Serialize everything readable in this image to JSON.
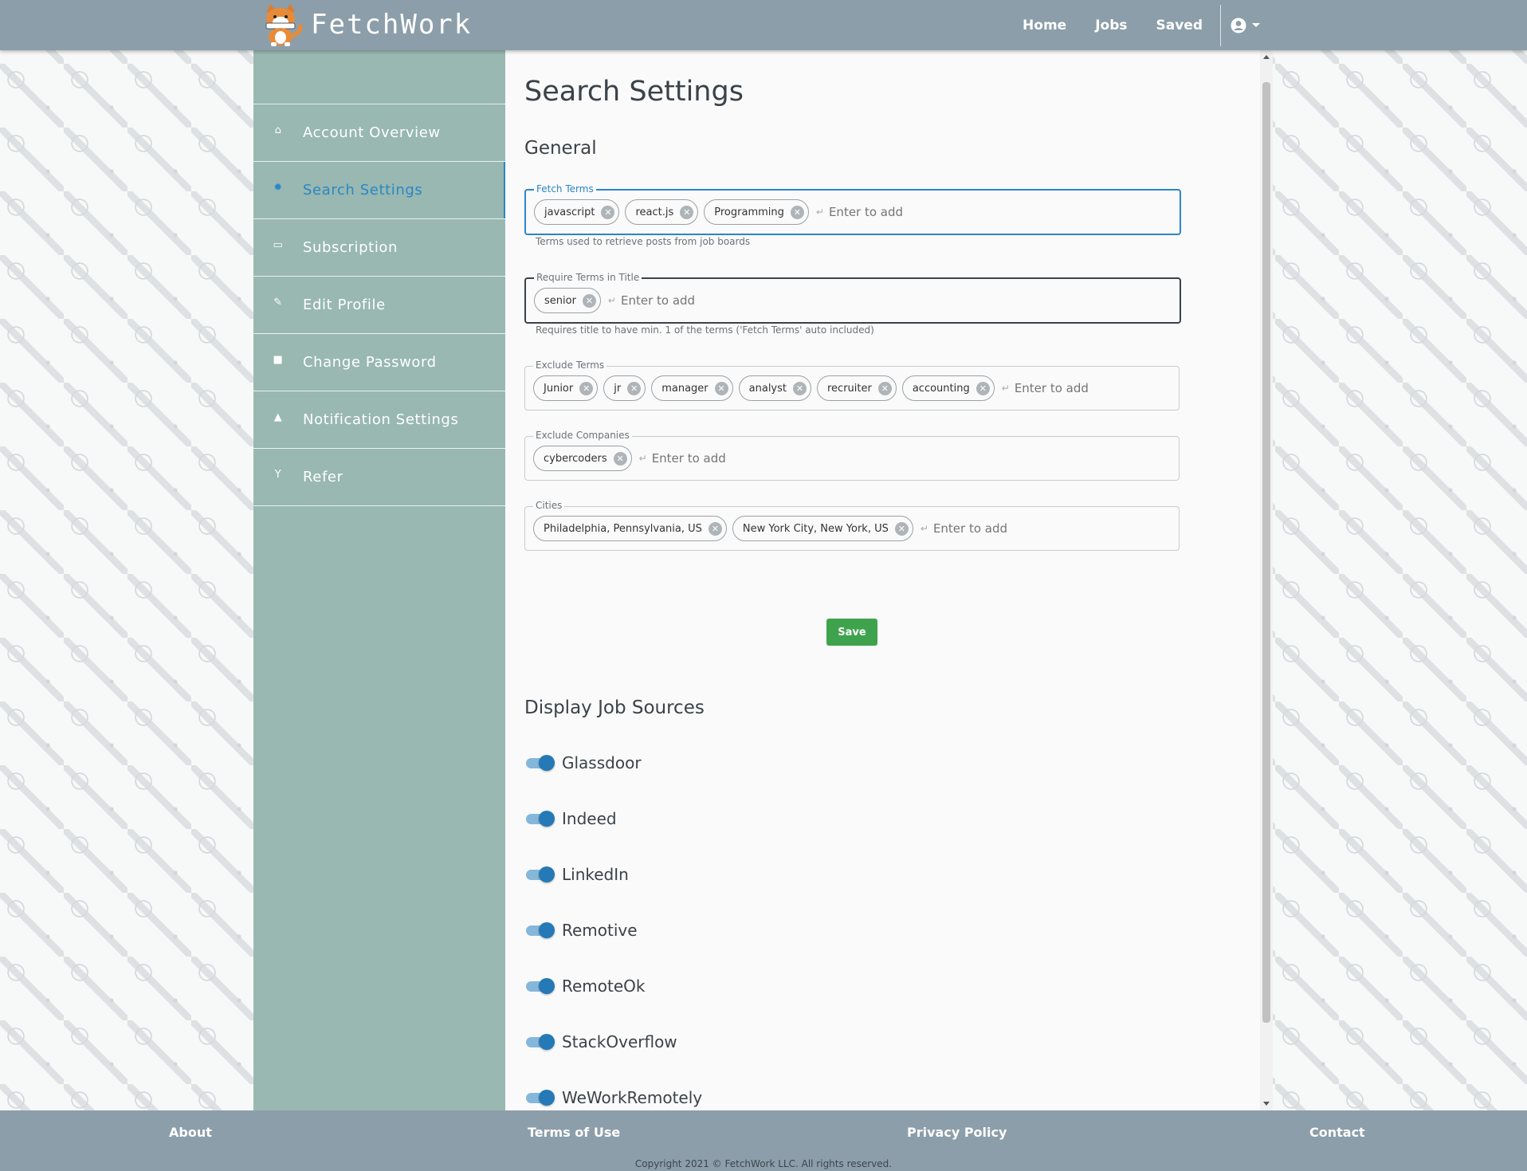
{
  "app": {
    "brand": "FetchWork"
  },
  "nav": {
    "home": "Home",
    "jobs": "Jobs",
    "saved": "Saved"
  },
  "sidebar": {
    "items": [
      {
        "label": "Account Overview",
        "icon": "home-icon"
      },
      {
        "label": "Search Settings",
        "icon": "gear-icon",
        "active": true
      },
      {
        "label": "Subscription",
        "icon": "credit-card-icon"
      },
      {
        "label": "Edit Profile",
        "icon": "pencil-icon"
      },
      {
        "label": "Change Password",
        "icon": "lock-icon"
      },
      {
        "label": "Notification Settings",
        "icon": "bell-icon"
      },
      {
        "label": "Refer",
        "icon": "fork-icon"
      }
    ]
  },
  "main": {
    "title": "Search Settings",
    "general_title": "General",
    "fetch_terms": {
      "legend": "Fetch Terms",
      "chips": [
        "javascript",
        "react.js",
        "Programming"
      ],
      "placeholder": "Enter to add",
      "helper": "Terms used to retrieve posts from job boards"
    },
    "require_terms": {
      "legend": "Require Terms in Title",
      "chips": [
        "senior"
      ],
      "placeholder": "Enter to add",
      "helper": "Requires title to have min. 1 of the terms ('Fetch Terms' auto included)"
    },
    "exclude_terms": {
      "legend": "Exclude Terms",
      "chips": [
        "Junior",
        "jr",
        "manager",
        "analyst",
        "recruiter",
        "accounting"
      ],
      "placeholder": "Enter to add"
    },
    "exclude_companies": {
      "legend": "Exclude Companies",
      "chips": [
        "cybercoders"
      ],
      "placeholder": "Enter to add"
    },
    "cities": {
      "legend": "Cities",
      "chips": [
        "Philadelphia, Pennsylvania, US",
        "New York City, New York, US"
      ],
      "placeholder": "Enter to add"
    },
    "save_label": "Save",
    "sources_title": "Display Job Sources",
    "sources": [
      {
        "label": "Glassdoor",
        "enabled": true
      },
      {
        "label": "Indeed",
        "enabled": true
      },
      {
        "label": "LinkedIn",
        "enabled": true
      },
      {
        "label": "Remotive",
        "enabled": true
      },
      {
        "label": "RemoteOk",
        "enabled": true
      },
      {
        "label": "StackOverflow",
        "enabled": true
      },
      {
        "label": "WeWorkRemotely",
        "enabled": true
      }
    ]
  },
  "footer": {
    "about": "About",
    "terms": "Terms of Use",
    "privacy": "Privacy Policy",
    "contact": "Contact",
    "copyright": "Copyright 2021 © FetchWork LLC. All rights reserved."
  },
  "colors": {
    "accent": "#2b86c5",
    "sidebar": "#98b8b1",
    "topbar": "#8c9ea9",
    "save": "#3fa34d"
  }
}
